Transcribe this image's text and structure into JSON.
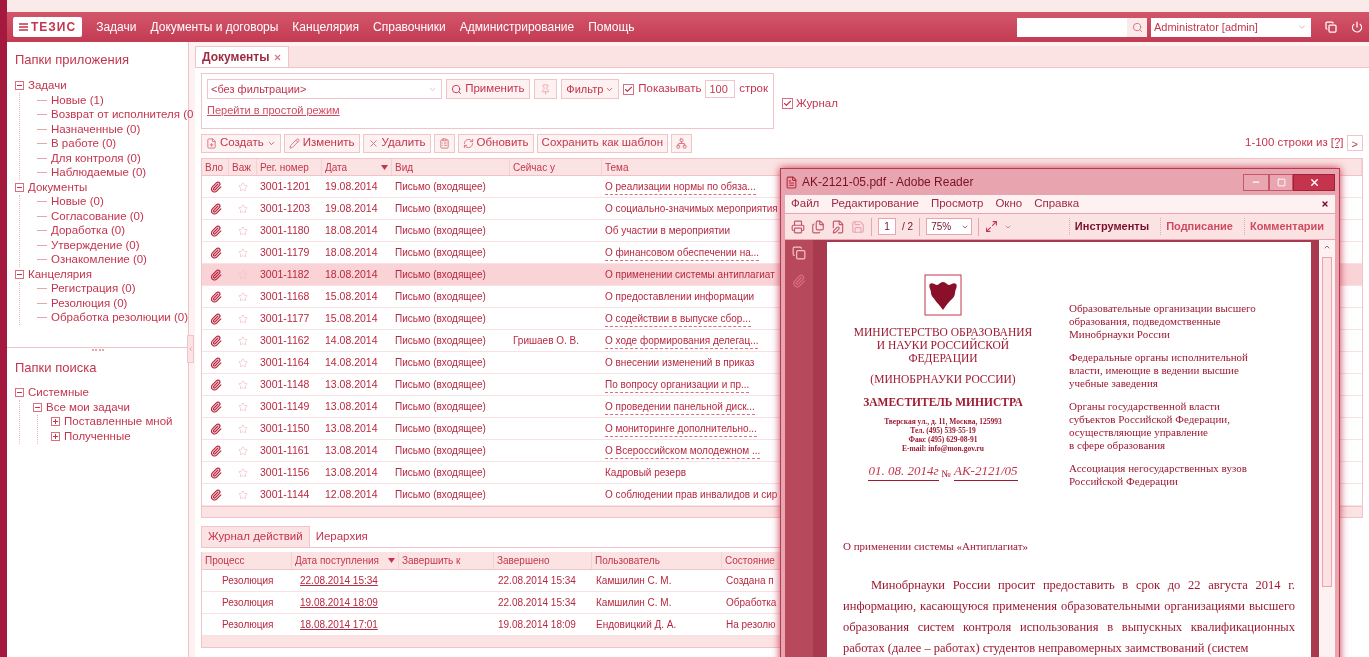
{
  "header": {
    "logo": "ТЕЗИС",
    "menu": [
      "Задачи",
      "Документы и договоры",
      "Канцелярия",
      "Справочники",
      "Администрирование",
      "Помощь"
    ],
    "user": "Administrator [admin]"
  },
  "sidebar": {
    "app_folders": {
      "title": "Папки приложения",
      "tree": [
        {
          "label": "Задачи",
          "expanded": true,
          "children": [
            {
              "label": "Новые (1)"
            },
            {
              "label": "Возврат от исполнителя (0"
            },
            {
              "label": "Назначенные (0)"
            },
            {
              "label": "В работе (0)"
            },
            {
              "label": "Для контроля (0)"
            },
            {
              "label": "Наблюдаемые (0)"
            }
          ]
        },
        {
          "label": "Документы",
          "expanded": true,
          "children": [
            {
              "label": "Новые (0)"
            },
            {
              "label": "Согласование (0)"
            },
            {
              "label": "Доработка (0)"
            },
            {
              "label": "Утверждение (0)"
            },
            {
              "label": "Ознакомление (0)"
            }
          ]
        },
        {
          "label": "Канцелярия",
          "expanded": true,
          "children": [
            {
              "label": "Регистрация (0)"
            },
            {
              "label": "Резолюция (0)"
            },
            {
              "label": "Обработка резолюции (0)"
            }
          ]
        }
      ]
    },
    "search_folders": {
      "title": "Папки поиска",
      "tree": [
        {
          "label": "Системные",
          "expanded": true,
          "children": [
            {
              "label": "Все мои задачи",
              "expanded": true,
              "children": [
                {
                  "label": "Поставленные мной",
                  "expanded": false
                },
                {
                  "label": "Полученные",
                  "expanded": false
                }
              ]
            }
          ]
        }
      ]
    }
  },
  "tabs": [
    {
      "label": "Документы",
      "selected": true,
      "closable": true
    }
  ],
  "filter": {
    "select": "<без фильтрации>",
    "apply": "Применить",
    "filter_button": "Фильтр",
    "show": {
      "label": "Показывать",
      "checked": true
    },
    "count": "100",
    "unit": "строк",
    "simple_mode_link": "Перейти в простой режим"
  },
  "journal": {
    "label": "Журнал",
    "checked": true
  },
  "toolbar": [
    {
      "label": "Создать",
      "dropdown": true
    },
    {
      "label": "Изменить",
      "dropdown": false
    },
    {
      "label": "Удалить",
      "dropdown": false
    },
    {
      "dropdown": false
    },
    {
      "label": "Обновить",
      "dropdown": false
    },
    {
      "label": "Сохранить как шаблон",
      "dropdown": false
    },
    {
      "dropdown": false
    }
  ],
  "pager": {
    "text": "1-100 строки из",
    "help": "[?]",
    "next": ">"
  },
  "table": {
    "columns": [
      {
        "label": "Вло"
      },
      {
        "label": "Важ"
      },
      {
        "label": "Рег. номер"
      },
      {
        "label": "Дата",
        "sorted": true
      },
      {
        "label": "Вид"
      },
      {
        "label": "Сейчас у"
      },
      {
        "label": "Тема"
      }
    ],
    "rows": [
      {
        "attachment": true,
        "important": false,
        "reg": "3001-1201",
        "date": "19.08.2014",
        "type": "Письмо (входящее)",
        "subject": "О реализации нормы по обяза...",
        "dotted": true,
        "selected": false
      },
      {
        "attachment": true,
        "important": false,
        "reg": "3001-1203",
        "date": "19.08.2014",
        "type": "Письмо (входящее)",
        "subject": "О социально-значимых мероприятия",
        "dotted": false,
        "selected": false
      },
      {
        "attachment": true,
        "important": false,
        "reg": "3001-1180",
        "date": "18.08.2014",
        "type": "Письмо (входящее)",
        "subject": "Об участии в мероприятии",
        "dotted": false,
        "selected": false
      },
      {
        "attachment": true,
        "important": false,
        "reg": "3001-1179",
        "date": "18.08.2014",
        "type": "Письмо (входящее)",
        "subject": "О финансовом обеспечении на...",
        "dotted": true,
        "selected": false
      },
      {
        "attachment": true,
        "important": false,
        "reg": "3001-1182",
        "date": "18.08.2014",
        "type": "Письмо (входящее)",
        "subject": "О применении системы антиплагиат",
        "dotted": false,
        "selected": true
      },
      {
        "attachment": true,
        "important": false,
        "reg": "3001-1168",
        "date": "15.08.2014",
        "type": "Письмо (входящее)",
        "subject": "О предоставлении информации",
        "dotted": false,
        "selected": false
      },
      {
        "attachment": true,
        "important": false,
        "reg": "3001-1177",
        "date": "15.08.2014",
        "type": "Письмо (входящее)",
        "subject": "О содействии в выпуске сбор...",
        "dotted": true,
        "selected": false
      },
      {
        "attachment": true,
        "important": false,
        "reg": "3001-1162",
        "date": "14.08.2014",
        "type": "Письмо (входящее)",
        "holder": "Гришаев О. В.",
        "subject": "О ходе формирования делегац...",
        "dotted": true,
        "selected": false
      },
      {
        "attachment": true,
        "important": false,
        "reg": "3001-1164",
        "date": "14.08.2014",
        "type": "Письмо (входящее)",
        "subject": "О внесении изменений в приказ",
        "dotted": false,
        "selected": false
      },
      {
        "attachment": true,
        "important": false,
        "reg": "3001-1148",
        "date": "13.08.2014",
        "type": "Письмо (входящее)",
        "subject": "По вопросу организации и пр...",
        "dotted": true,
        "selected": false
      },
      {
        "attachment": true,
        "important": false,
        "reg": "3001-1149",
        "date": "13.08.2014",
        "type": "Письмо (входящее)",
        "subject": "О проведении панельной диск...",
        "dotted": true,
        "selected": false
      },
      {
        "attachment": true,
        "important": false,
        "reg": "3001-1150",
        "date": "13.08.2014",
        "type": "Письмо (входящее)",
        "subject": "О мониторинге дополнительно...",
        "dotted": true,
        "selected": false
      },
      {
        "attachment": true,
        "important": false,
        "reg": "3001-1161",
        "date": "13.08.2014",
        "type": "Письмо (входящее)",
        "subject": "О Всероссийском молодежном ...",
        "dotted": true,
        "selected": false
      },
      {
        "attachment": true,
        "important": false,
        "reg": "3001-1156",
        "date": "13.08.2014",
        "type": "Письмо (входящее)",
        "subject": "Кадровый резерв",
        "dotted": false,
        "selected": false
      },
      {
        "attachment": true,
        "important": false,
        "reg": "3001-1144",
        "date": "12.08.2014",
        "type": "Письмо (входящее)",
        "subject": "О соблюдении прав инвалидов и сир",
        "dotted": false,
        "selected": false
      }
    ]
  },
  "bottom": {
    "tabs": [
      {
        "label": "Журнал действий",
        "selected": true
      },
      {
        "label": "Иерархия",
        "selected": false
      }
    ],
    "columns": [
      {
        "label": "Процесс"
      },
      {
        "label": "Дата поступления",
        "sorted": true
      },
      {
        "label": "Завершить к"
      },
      {
        "label": "Завершено"
      },
      {
        "label": "Пользователь"
      },
      {
        "label": "Состояние"
      }
    ],
    "rows": [
      {
        "process": "Резолюция",
        "received": "22.08.2014 15:34",
        "done": "22.08.2014 15:34",
        "user": "Камшилин С. М.",
        "state": "Создана п"
      },
      {
        "process": "Резолюция",
        "received": "19.08.2014 18:09",
        "done": "22.08.2014 15:34",
        "user": "Камшилин С. М.",
        "state": "Обработка"
      },
      {
        "process": "Резолюция",
        "received": "18.08.2014 17:01",
        "done": "19.08.2014 18:09",
        "user": "Ендовицкий Д. А.",
        "state": "На резолю"
      }
    ]
  },
  "pdf_window": {
    "title": "AK-2121-05.pdf - Adobe Reader",
    "menu": [
      "Файл",
      "Редактирование",
      "Просмотр",
      "Окно",
      "Справка"
    ],
    "page": "1",
    "pages": "/ 2",
    "zoom": "75%",
    "tabs": [
      {
        "label": "Инструменты",
        "selected": true
      },
      {
        "label": "Подписание",
        "selected": false
      },
      {
        "label": "Комментарии",
        "selected": false
      }
    ],
    "document": {
      "org": [
        "МИНИСТЕРСТВО ОБРАЗОВАНИЯ",
        "И НАУКИ РОССИЙСКОЙ",
        "ФЕДЕРАЦИИ"
      ],
      "org_short": "(МИНОБРНАУКИ РОССИИ)",
      "position": "ЗАМЕСТИТЕЛЬ МИНИСТРА",
      "contacts": [
        "Тверская ул., д. 11, Москва, 125993",
        "Тел. (495) 539-55-19",
        "Факс (495) 629-08-91",
        "E-mail: info@mon.gov.ru"
      ],
      "date": "01. 08. 2014г",
      "number_sign": "№",
      "number": "АК-2121/05",
      "addressees": [
        [
          "Образовательные организации высшего",
          "образования, подведомственные",
          "Минобрнауки России"
        ],
        [
          "Федеральные органы исполнительной",
          "власти, имеющие в ведении высшие",
          "учебные заведения"
        ],
        [
          "Органы государственной власти",
          "субъектов Российской Федерации,",
          "осуществляющие управление",
          "в сфере образования"
        ],
        [
          "Ассоциация негосударственных вузов",
          "Российской Федерации"
        ]
      ],
      "subject": "О применении системы «Антиплагиат»",
      "body": "Минобрнауки России просит предоставить в срок до 22 августа 2014 г. информацию, касающуюся применения образовательными организациями высшего образования систем контроля использования в выпускных квалификационных работах (далее – работах) студентов неправомерных заимствований (систем"
    }
  }
}
